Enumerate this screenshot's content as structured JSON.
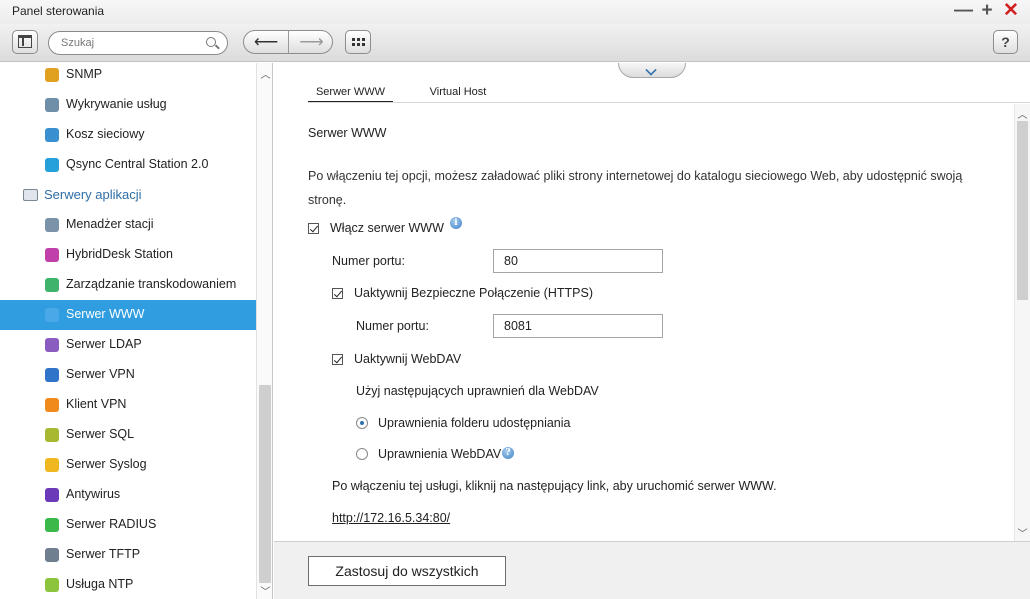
{
  "window": {
    "title": "Panel sterowania",
    "controls": {
      "minimize": "—",
      "maximize": "+",
      "close": "✕"
    }
  },
  "toolbar": {
    "search_placeholder": "Szukaj",
    "back_icon": "arrow-left-icon",
    "forward_icon": "arrow-right-icon",
    "apps_icon": "apps-grid-icon",
    "help_label": "?"
  },
  "sidebar": {
    "items": [
      {
        "label": "SNMP",
        "icon": "bar-chart-icon",
        "color": "#e0a020",
        "type": "item"
      },
      {
        "label": "Wykrywanie usług",
        "icon": "discovery-icon",
        "color": "#6f8ea8",
        "type": "item"
      },
      {
        "label": "Kosz sieciowy",
        "icon": "recycle-bin-icon",
        "color": "#3a8fd0",
        "type": "item"
      },
      {
        "label": "Qsync Central Station 2.0",
        "icon": "sync-icon",
        "color": "#25a0d8",
        "type": "item"
      },
      {
        "label": "Serwery aplikacji",
        "icon": "server-category-icon",
        "color": "#7a8794",
        "type": "category"
      },
      {
        "label": "Menadżer stacji",
        "icon": "station-manager-icon",
        "color": "#7b93a8",
        "type": "item"
      },
      {
        "label": "HybridDesk Station",
        "icon": "hybriddesk-icon",
        "color": "#c03fa8",
        "type": "item"
      },
      {
        "label": "Zarządzanie transkodowaniem",
        "icon": "transcode-icon",
        "color": "#3fb36b",
        "type": "item"
      },
      {
        "label": "Serwer WWW",
        "icon": "web-server-icon",
        "color": "#4aa8e8",
        "type": "active"
      },
      {
        "label": "Serwer LDAP",
        "icon": "ldap-icon",
        "color": "#8a5cc0",
        "type": "item"
      },
      {
        "label": "Serwer VPN",
        "icon": "vpn-server-icon",
        "color": "#2f74c8",
        "type": "item"
      },
      {
        "label": "Klient VPN",
        "icon": "vpn-client-icon",
        "color": "#f08a1c",
        "type": "item"
      },
      {
        "label": "Serwer SQL",
        "icon": "sql-server-icon",
        "color": "#a8b830",
        "type": "item"
      },
      {
        "label": "Serwer Syslog",
        "icon": "syslog-icon",
        "color": "#f0b820",
        "type": "item"
      },
      {
        "label": "Antywirus",
        "icon": "antivirus-icon",
        "color": "#6a3ab8",
        "type": "item"
      },
      {
        "label": "Serwer RADIUS",
        "icon": "radius-icon",
        "color": "#3cb84a",
        "type": "item"
      },
      {
        "label": "Serwer TFTP",
        "icon": "tftp-icon",
        "color": "#6f7f90",
        "type": "item"
      },
      {
        "label": "Usługa NTP",
        "icon": "ntp-clock-icon",
        "color": "#8cc43c",
        "type": "item"
      }
    ]
  },
  "tabs": [
    {
      "label": "Serwer WWW",
      "active": true
    },
    {
      "label": "Virtual Host",
      "active": false
    }
  ],
  "content": {
    "section_title": "Serwer WWW",
    "description": "Po włączeniu tej opcji, możesz załadować pliki strony internetowej do katalogu sieciowego Web, aby udostępnić swoją stronę.",
    "enable_www": {
      "label": "Włącz serwer WWW",
      "checked": true
    },
    "port_label": "Numer portu:",
    "port_value": "80",
    "enable_https": {
      "label": "Uaktywnij Bezpieczne Połączenie (HTTPS)",
      "checked": true
    },
    "https_port_label": "Numer portu:",
    "https_port_value": "8081",
    "enable_webdav": {
      "label": "Uaktywnij WebDAV",
      "checked": true
    },
    "webdav_prompt": "Użyj następujących uprawnień dla WebDAV",
    "radio_folder": {
      "label": "Uprawnienia folderu udostępniania",
      "selected": true
    },
    "radio_webdav": {
      "label": "Uprawnienia WebDAV",
      "selected": false
    },
    "link_hint": "Po włączeniu tej usługi, kliknij na następujący link, aby uruchomić serwer WWW.",
    "link_url": "http://172.16.5.34:80/"
  },
  "footer": {
    "apply_label": "Zastosuj do wszystkich"
  },
  "colors": {
    "accent": "#2f9de0",
    "category_text": "#2f6ea7",
    "close": "#d02020"
  }
}
